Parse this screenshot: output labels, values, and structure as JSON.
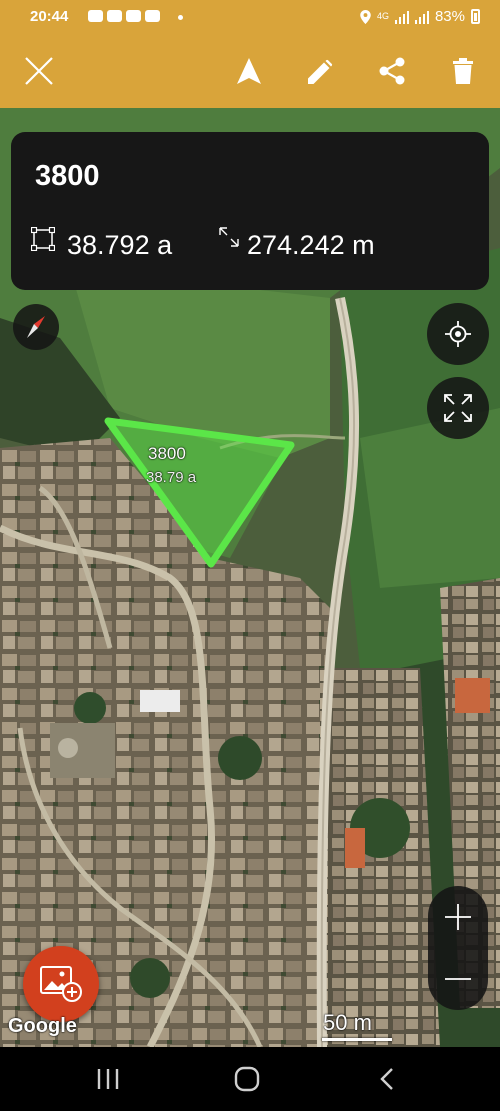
{
  "status_bar": {
    "time": "20:44",
    "network": "4G",
    "battery": "83%"
  },
  "card": {
    "title": "3800",
    "area": "38.792 a",
    "perimeter": "274.242 m"
  },
  "polygon": {
    "title": "3800",
    "area": "38.79 a",
    "color": "#5be648"
  },
  "map": {
    "attribution": "Google",
    "scale": "50 m"
  },
  "colors": {
    "toolbar": "#d9a43a",
    "card_bg": "#171717",
    "fab": "#d2401e",
    "polygon": "#5be648"
  },
  "icons": {
    "toolbar": [
      "close-icon",
      "navigate-icon",
      "edit-icon",
      "share-icon",
      "delete-icon"
    ],
    "map": [
      "compass-icon",
      "my-location-icon",
      "fullscreen-icon",
      "zoom-in-icon",
      "zoom-out-icon",
      "add-photo-icon"
    ],
    "nav": [
      "recent-apps-icon",
      "home-icon",
      "back-icon"
    ]
  }
}
